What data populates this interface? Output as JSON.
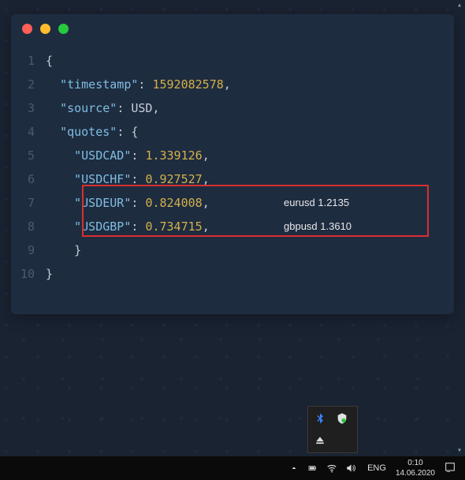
{
  "code": {
    "lines": [
      "1",
      "2",
      "3",
      "4",
      "5",
      "6",
      "7",
      "8",
      "9",
      "10"
    ],
    "l1_open": "{",
    "l2_key": "\"timestamp\"",
    "l2_colon": ": ",
    "l2_val": "1592082578",
    "l2_end": ",",
    "l3_key": "\"source\"",
    "l3_colon": ": ",
    "l3_val": "USD",
    "l3_end": ",",
    "l4_key": "\"quotes\"",
    "l4_colon": ": {",
    "l5_key": "\"USDCAD\"",
    "l5_colon": ": ",
    "l5_val": "1.339126",
    "l5_end": ",",
    "l6_key": "\"USDCHF\"",
    "l6_colon": ": ",
    "l6_val": "0.927527",
    "l6_end": ",",
    "l7_key": "\"USDEUR\"",
    "l7_colon": ": ",
    "l7_val": "0.824008",
    "l7_end": ",",
    "l8_key": "\"USDGBP\"",
    "l8_colon": ": ",
    "l8_val": "0.734715",
    "l8_end": ",",
    "l9_close": "}",
    "l10_close": "}"
  },
  "annotations": {
    "line7": "eurusd 1.2135",
    "line8": "gbpusd  1.3610"
  },
  "taskbar": {
    "lang": "ENG",
    "time": "0:10",
    "date": "14.06.2020"
  }
}
